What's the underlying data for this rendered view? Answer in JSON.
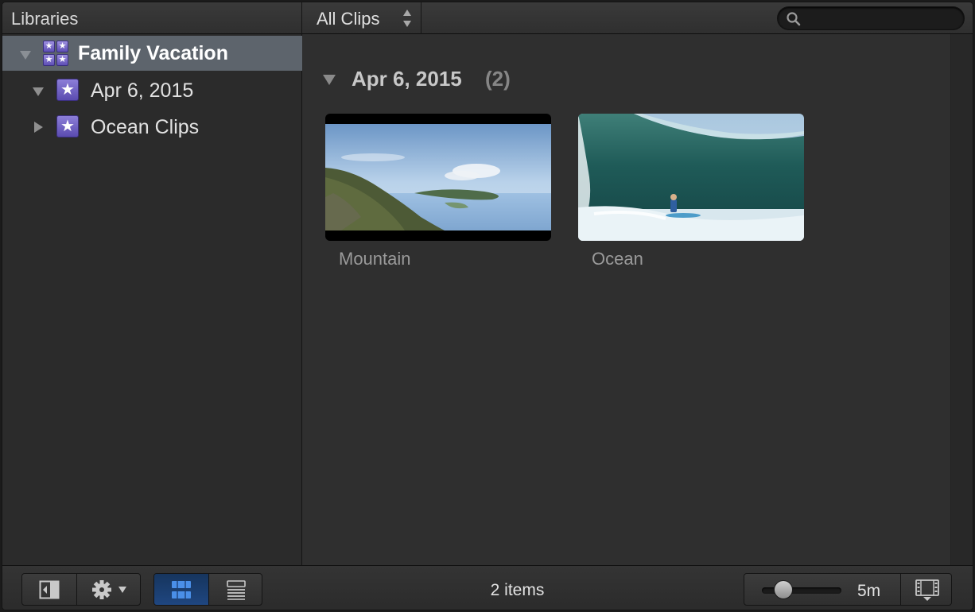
{
  "header": {
    "libraries_label": "Libraries",
    "filter_label": "All Clips",
    "search_placeholder": ""
  },
  "sidebar": {
    "items": [
      {
        "label": "Family Vacation",
        "icon": "library-icon",
        "expanded": true,
        "selected": true
      },
      {
        "label": "Apr 6, 2015",
        "icon": "event-star-icon",
        "expanded": true,
        "selected": false
      },
      {
        "label": "Ocean Clips",
        "icon": "event-star-icon",
        "expanded": false,
        "selected": false
      }
    ]
  },
  "browser": {
    "section_date": "Apr 6, 2015",
    "section_count": "(2)",
    "clips": [
      {
        "name": "Mountain",
        "thumbnail": "mountain-landscape"
      },
      {
        "name": "Ocean",
        "thumbnail": "surfer-wave"
      }
    ]
  },
  "footer": {
    "items_count": "2 items",
    "zoom_value": "5m",
    "zoom_level": 0.2
  },
  "colors": {
    "selection": "#5d646c",
    "active_button": "#1f4680",
    "event_icon": "#6f61c4",
    "background": "#2f2f2f"
  }
}
